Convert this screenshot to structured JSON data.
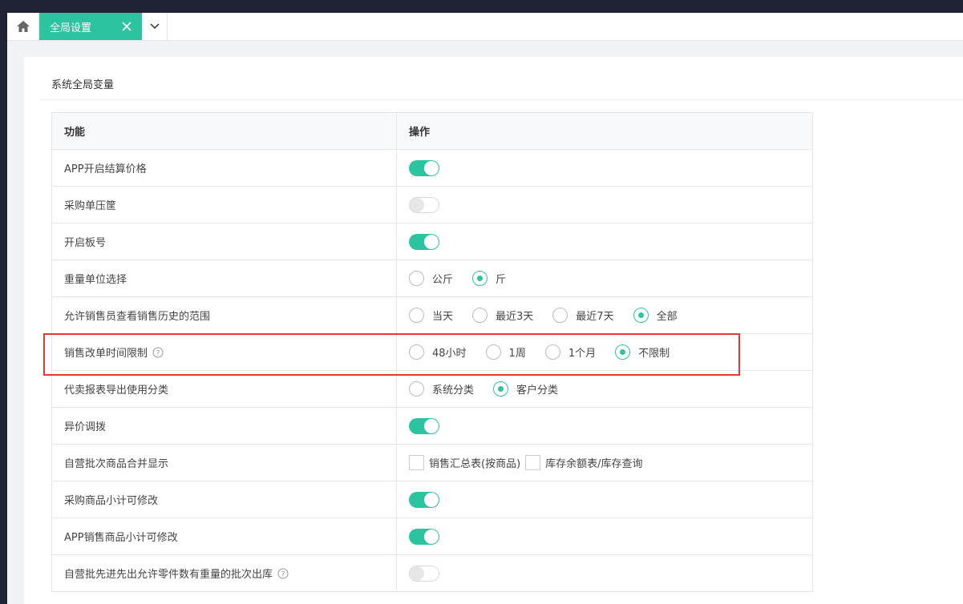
{
  "tabs": {
    "home_icon": "home-icon",
    "active_label": "全局设置"
  },
  "card": {
    "title": "系统全局变量"
  },
  "table": {
    "col_func": "功能",
    "col_op": "操作"
  },
  "rows": [
    {
      "label": "APP开启结算价格",
      "type": "switch",
      "value": "on"
    },
    {
      "label": "采购单压筐",
      "type": "switch",
      "value": "off"
    },
    {
      "label": "开启板号",
      "type": "switch",
      "value": "on"
    },
    {
      "label": "重量单位选择",
      "type": "radio",
      "options": [
        "公斤",
        "斤"
      ],
      "selected": "斤"
    },
    {
      "label": "允许销售员查看销售历史的范围",
      "type": "radio",
      "options": [
        "当天",
        "最近3天",
        "最近7天",
        "全部"
      ],
      "selected": "全部"
    },
    {
      "label": "销售改单时间限制",
      "type": "radio",
      "help": true,
      "options": [
        "48小时",
        "1周",
        "1个月",
        "不限制"
      ],
      "selected": "不限制"
    },
    {
      "label": "代卖报表导出使用分类",
      "type": "radio",
      "options": [
        "系统分类",
        "客户分类"
      ],
      "selected": "客户分类"
    },
    {
      "label": "异价调拨",
      "type": "switch",
      "value": "on"
    },
    {
      "label": "自营批次商品合并显示",
      "type": "checkbox",
      "options": [
        "销售汇总表(按商品)",
        "库存余额表/库存查询"
      ],
      "checked": []
    },
    {
      "label": "采购商品小计可修改",
      "type": "switch",
      "value": "on"
    },
    {
      "label": "APP销售商品小计可修改",
      "type": "switch",
      "value": "on"
    },
    {
      "label": "自营批先进先出允许零件数有重量的批次出库",
      "type": "switch",
      "value": "off",
      "help": true
    }
  ],
  "colors": {
    "accent": "#2cc4a0",
    "highlight": "#e53935"
  }
}
